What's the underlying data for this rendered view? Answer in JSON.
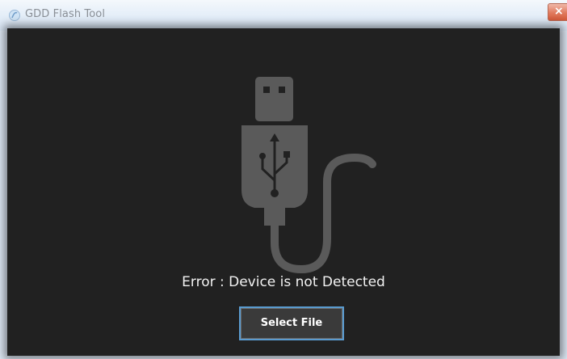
{
  "window": {
    "title": "GDD Flash Tool",
    "close_icon": "close-icon"
  },
  "main": {
    "status_message": "Error : Device is not Detected",
    "select_file_label": "Select File",
    "graphic_icon": "usb-cable-icon"
  },
  "colors": {
    "content_background": "#212121",
    "icon_gray": "#5a5a5a",
    "button_border": "#5a9bd0",
    "message_text": "#f2f2f2"
  }
}
